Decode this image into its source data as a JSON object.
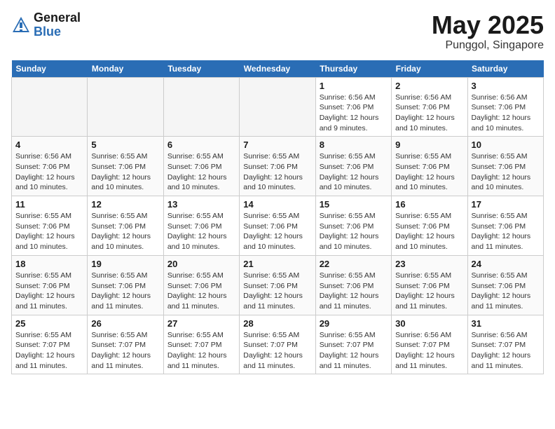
{
  "header": {
    "logo_general": "General",
    "logo_blue": "Blue",
    "month_title": "May 2025",
    "location": "Punggol, Singapore"
  },
  "days_of_week": [
    "Sunday",
    "Monday",
    "Tuesday",
    "Wednesday",
    "Thursday",
    "Friday",
    "Saturday"
  ],
  "weeks": [
    [
      {
        "day": "",
        "info": ""
      },
      {
        "day": "",
        "info": ""
      },
      {
        "day": "",
        "info": ""
      },
      {
        "day": "",
        "info": ""
      },
      {
        "day": "1",
        "info": "Sunrise: 6:56 AM\nSunset: 7:06 PM\nDaylight: 12 hours\nand 9 minutes."
      },
      {
        "day": "2",
        "info": "Sunrise: 6:56 AM\nSunset: 7:06 PM\nDaylight: 12 hours\nand 10 minutes."
      },
      {
        "day": "3",
        "info": "Sunrise: 6:56 AM\nSunset: 7:06 PM\nDaylight: 12 hours\nand 10 minutes."
      }
    ],
    [
      {
        "day": "4",
        "info": "Sunrise: 6:56 AM\nSunset: 7:06 PM\nDaylight: 12 hours\nand 10 minutes."
      },
      {
        "day": "5",
        "info": "Sunrise: 6:55 AM\nSunset: 7:06 PM\nDaylight: 12 hours\nand 10 minutes."
      },
      {
        "day": "6",
        "info": "Sunrise: 6:55 AM\nSunset: 7:06 PM\nDaylight: 12 hours\nand 10 minutes."
      },
      {
        "day": "7",
        "info": "Sunrise: 6:55 AM\nSunset: 7:06 PM\nDaylight: 12 hours\nand 10 minutes."
      },
      {
        "day": "8",
        "info": "Sunrise: 6:55 AM\nSunset: 7:06 PM\nDaylight: 12 hours\nand 10 minutes."
      },
      {
        "day": "9",
        "info": "Sunrise: 6:55 AM\nSunset: 7:06 PM\nDaylight: 12 hours\nand 10 minutes."
      },
      {
        "day": "10",
        "info": "Sunrise: 6:55 AM\nSunset: 7:06 PM\nDaylight: 12 hours\nand 10 minutes."
      }
    ],
    [
      {
        "day": "11",
        "info": "Sunrise: 6:55 AM\nSunset: 7:06 PM\nDaylight: 12 hours\nand 10 minutes."
      },
      {
        "day": "12",
        "info": "Sunrise: 6:55 AM\nSunset: 7:06 PM\nDaylight: 12 hours\nand 10 minutes."
      },
      {
        "day": "13",
        "info": "Sunrise: 6:55 AM\nSunset: 7:06 PM\nDaylight: 12 hours\nand 10 minutes."
      },
      {
        "day": "14",
        "info": "Sunrise: 6:55 AM\nSunset: 7:06 PM\nDaylight: 12 hours\nand 10 minutes."
      },
      {
        "day": "15",
        "info": "Sunrise: 6:55 AM\nSunset: 7:06 PM\nDaylight: 12 hours\nand 10 minutes."
      },
      {
        "day": "16",
        "info": "Sunrise: 6:55 AM\nSunset: 7:06 PM\nDaylight: 12 hours\nand 10 minutes."
      },
      {
        "day": "17",
        "info": "Sunrise: 6:55 AM\nSunset: 7:06 PM\nDaylight: 12 hours\nand 11 minutes."
      }
    ],
    [
      {
        "day": "18",
        "info": "Sunrise: 6:55 AM\nSunset: 7:06 PM\nDaylight: 12 hours\nand 11 minutes."
      },
      {
        "day": "19",
        "info": "Sunrise: 6:55 AM\nSunset: 7:06 PM\nDaylight: 12 hours\nand 11 minutes."
      },
      {
        "day": "20",
        "info": "Sunrise: 6:55 AM\nSunset: 7:06 PM\nDaylight: 12 hours\nand 11 minutes."
      },
      {
        "day": "21",
        "info": "Sunrise: 6:55 AM\nSunset: 7:06 PM\nDaylight: 12 hours\nand 11 minutes."
      },
      {
        "day": "22",
        "info": "Sunrise: 6:55 AM\nSunset: 7:06 PM\nDaylight: 12 hours\nand 11 minutes."
      },
      {
        "day": "23",
        "info": "Sunrise: 6:55 AM\nSunset: 7:06 PM\nDaylight: 12 hours\nand 11 minutes."
      },
      {
        "day": "24",
        "info": "Sunrise: 6:55 AM\nSunset: 7:06 PM\nDaylight: 12 hours\nand 11 minutes."
      }
    ],
    [
      {
        "day": "25",
        "info": "Sunrise: 6:55 AM\nSunset: 7:07 PM\nDaylight: 12 hours\nand 11 minutes."
      },
      {
        "day": "26",
        "info": "Sunrise: 6:55 AM\nSunset: 7:07 PM\nDaylight: 12 hours\nand 11 minutes."
      },
      {
        "day": "27",
        "info": "Sunrise: 6:55 AM\nSunset: 7:07 PM\nDaylight: 12 hours\nand 11 minutes."
      },
      {
        "day": "28",
        "info": "Sunrise: 6:55 AM\nSunset: 7:07 PM\nDaylight: 12 hours\nand 11 minutes."
      },
      {
        "day": "29",
        "info": "Sunrise: 6:55 AM\nSunset: 7:07 PM\nDaylight: 12 hours\nand 11 minutes."
      },
      {
        "day": "30",
        "info": "Sunrise: 6:56 AM\nSunset: 7:07 PM\nDaylight: 12 hours\nand 11 minutes."
      },
      {
        "day": "31",
        "info": "Sunrise: 6:56 AM\nSunset: 7:07 PM\nDaylight: 12 hours\nand 11 minutes."
      }
    ]
  ]
}
